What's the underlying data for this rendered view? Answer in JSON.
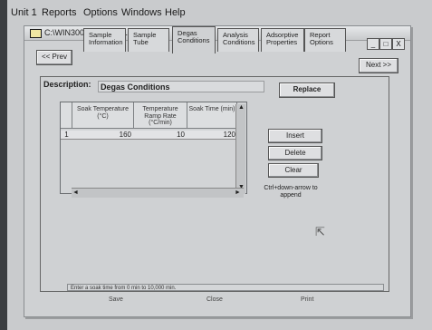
{
  "menubar": {
    "items": [
      "Unit 1",
      "Reports",
      "Options",
      "Windows",
      "Help"
    ]
  },
  "window": {
    "title": "C:\\WIN3000\\DATA\\001-736.SMP",
    "controls": [
      "_",
      "□",
      "X"
    ]
  },
  "nav": {
    "prev_label": "<< Prev",
    "next_label": "Next >>"
  },
  "tabs": [
    {
      "label": "Sample Information"
    },
    {
      "label": "Sample Tube"
    },
    {
      "label": "Degas Conditions",
      "active": true
    },
    {
      "label": "Analysis Conditions"
    },
    {
      "label": "Adsorptive Properties"
    },
    {
      "label": "Report Options"
    }
  ],
  "description": {
    "label": "Description:",
    "value": "Degas Conditions"
  },
  "buttons": {
    "replace": "Replace",
    "insert": "Insert",
    "delete": "Delete",
    "clear": "Clear",
    "append_hint": "Ctrl+down-arrow to append"
  },
  "grid": {
    "columns": [
      "Soak Temperature (°C)",
      "Temperature Ramp Rate (°C/min)",
      "Soak Time (min)"
    ],
    "rows": [
      {
        "index": "1",
        "cells": [
          "160",
          "10",
          "120"
        ]
      }
    ]
  },
  "status": "Enter a soak time from 0 min to 10,000 min.",
  "footer": {
    "save": "Save",
    "close": "Close",
    "print": "Print"
  }
}
